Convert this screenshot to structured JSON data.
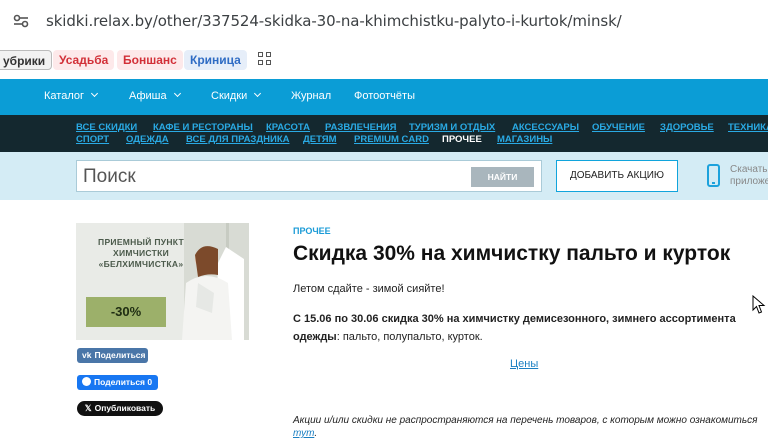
{
  "browser": {
    "url": "skidki.relax.by/other/337524-skidka-30-na-khimchistku-palyto-i-kurtok/minsk/",
    "bookmarks": [
      "убрики",
      "Усадьба",
      "Боншанс",
      "Криница"
    ]
  },
  "nav": {
    "items": [
      "Каталог",
      "Афиша",
      "Скидки",
      "Журнал",
      "Фотоотчёты"
    ]
  },
  "categories": {
    "row1": [
      "ВСЕ СКИДКИ",
      "КАФЕ И РЕСТОРАНЫ",
      "КРАСОТА",
      "РАЗВЛЕЧЕНИЯ",
      "ТУРИЗМ И ОТДЫХ",
      "АКСЕССУАРЫ",
      "ОБУЧЕНИЕ",
      "ЗДОРОВЬЕ",
      "ТЕХНИКА"
    ],
    "row2": [
      "СПОРТ",
      "ОДЕЖДА",
      "ВСЕ ДЛЯ ПРАЗДНИКА",
      "ДЕТЯМ",
      "PREMIUM CARD",
      "ПРОЧЕЕ",
      "МАГАЗИНЫ"
    ],
    "active": "ПРОЧЕЕ"
  },
  "search": {
    "placeholder": "Поиск",
    "button": "НАЙТИ",
    "add_button": "ДОБАВИТЬ АКЦИЮ",
    "app_line1": "Скачать",
    "app_line2": "приложе"
  },
  "promo_image": {
    "text": "ПРИЕМНЫЙ ПУНКТ ХИМЧИСТКИ «БЕЛХИМЧИСТКА»",
    "discount": "-30%"
  },
  "share": {
    "vk": "Поделиться",
    "fb": "Поделиться 0",
    "x": "Опубликовать"
  },
  "deal": {
    "category": "ПРОЧЕЕ",
    "title": "Скидка 30% на химчистку пальто и курток",
    "slogan": "Летом сдайте - зимой сияйте!",
    "bold_text": "С 15.06 по 30.06 скидка 30% на химчистку демисезонного, зимнего ассортимента одежды",
    "rest_text": ": пальто, полупальто, курток.",
    "prices_link": "Цены",
    "note_text": "Акции и/или скидки не распространяются на перечень товаров, с которым можно ознакомиться ",
    "note_link": "тут",
    "note_end": "."
  },
  "colors": {
    "nav_blue": "#0b9dd6",
    "nav_dark": "#14282f",
    "link_blue": "#2aaae4",
    "search_bar": "#d4ecf5"
  }
}
